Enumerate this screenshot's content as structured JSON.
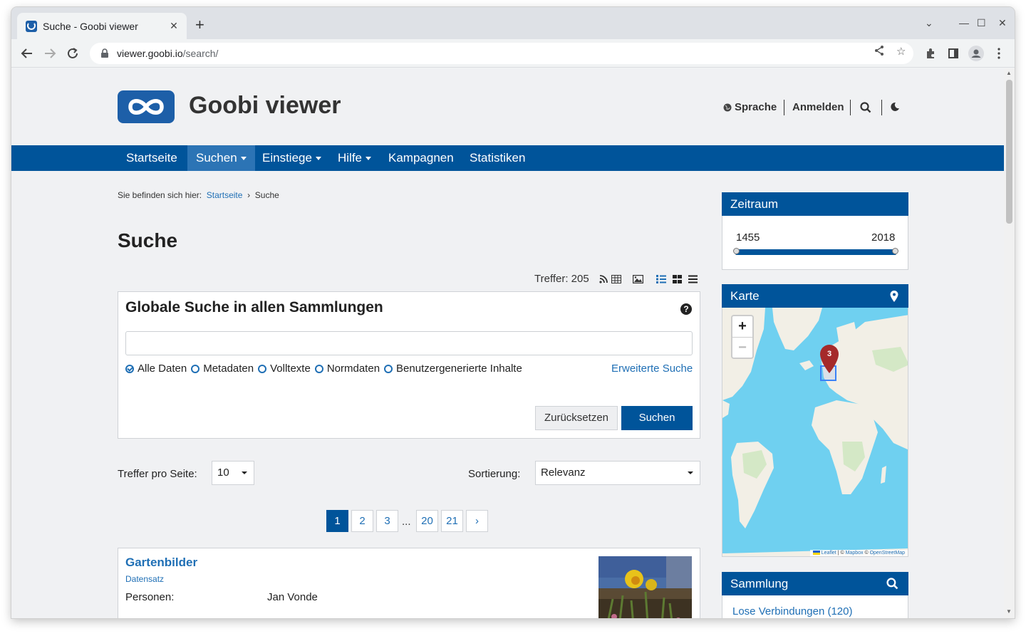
{
  "browser": {
    "tab_title": "Suche - Goobi viewer",
    "url_host": "viewer.goobi.io",
    "url_path": "/search/"
  },
  "header": {
    "brand": "Goobi viewer",
    "language": "Sprache",
    "login": "Anmelden"
  },
  "nav": {
    "items": [
      "Startseite",
      "Suchen",
      "Einstiege",
      "Hilfe",
      "Kampagnen",
      "Statistiken"
    ],
    "active": "Suchen"
  },
  "breadcrumb": {
    "prefix": "Sie befinden sich hier:",
    "home": "Startseite",
    "sep": "›",
    "current": "Suche"
  },
  "page_title": "Suche",
  "hits_label": "Treffer: 205",
  "search": {
    "title": "Globale Suche in allen Sammlungen",
    "help": "?",
    "input_value": "",
    "options": [
      "Alle Daten",
      "Metadaten",
      "Volltexte",
      "Normdaten",
      "Benutzergenerierte Inhalte"
    ],
    "selected_option": "Alle Daten",
    "advanced_link": "Erweiterte Suche",
    "reset_label": "Zurücksetzen",
    "submit_label": "Suchen"
  },
  "controls": {
    "per_page_label": "Treffer pro Seite:",
    "per_page_value": "10",
    "sort_label": "Sortierung:",
    "sort_value": "Relevanz"
  },
  "pagination": {
    "pages": [
      "1",
      "2",
      "3",
      "20",
      "21"
    ],
    "current": "1",
    "ellipsis": "...",
    "next": "›"
  },
  "result": {
    "title": "Gartenbilder",
    "type": "Datensatz",
    "meta_key": "Personen:",
    "meta_value": "Jan Vonde"
  },
  "sidebar": {
    "timerange": {
      "title": "Zeitraum",
      "from": "1455",
      "to": "2018"
    },
    "map": {
      "title": "Karte",
      "marker_count": "3",
      "zoom_in": "+",
      "zoom_out": "−",
      "attribution_leaflet": "Leaflet",
      "attribution_sep1": "| ©",
      "attribution_mapbox": "Mapbox",
      "attribution_sep2": "©",
      "attribution_osm": "OpenStreetMap"
    },
    "collection": {
      "title": "Sammlung",
      "first_item": "Lose Verbindungen (120)"
    }
  },
  "colors": {
    "primary": "#00549a",
    "nav_active": "#2c74b5",
    "link": "#1f6fb5",
    "page_bg": "#f0f1f3",
    "map_water": "#6fd0f0"
  },
  "icons": {
    "rss": "rss-icon",
    "table": "table-view-icon",
    "image": "image-view-icon",
    "list": "list-details-icon",
    "tiles": "tiles-view-icon",
    "compact": "list-compact-icon"
  }
}
